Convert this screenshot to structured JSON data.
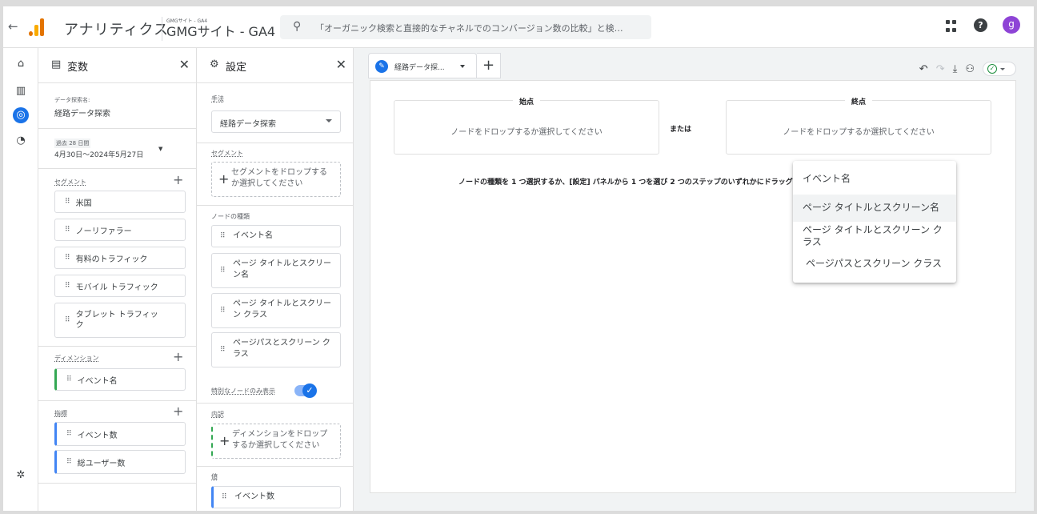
{
  "topbar": {
    "app_name": "アナリティクス",
    "property_small": "GMGサイト - GA4",
    "property_name": "GMGサイト - GA4",
    "search_placeholder": "「オーガニック検索と直接的なチャネルでのコンバージョン数の比較」と検…",
    "avatar_letter": "g",
    "help_label": "?"
  },
  "variables": {
    "title": "変数",
    "exploration_name_label": "データ探索名:",
    "exploration_name": "経路データ探索",
    "date_label": "過去 28 日間",
    "date_range": "4月30日～2024年5月27日",
    "segments_label": "セグメント",
    "segments": [
      "米国",
      "ノーリファラー",
      "有料のトラフィック",
      "モバイル トラフィック",
      "タブレット トラフィック"
    ],
    "dimensions_label": "ディメンション",
    "dimensions": [
      "イベント名"
    ],
    "metrics_label": "指標",
    "metrics": [
      "イベント数",
      "総ユーザー数"
    ]
  },
  "settings": {
    "title": "設定",
    "technique_label": "手法",
    "technique_value": "経路データ探索",
    "segment_label": "セグメント",
    "segment_drop": "セグメントをドロップするか選択してください",
    "node_type_label": "ノードの種類",
    "node_types": [
      "イベント名",
      "ページ タイトルとスクリーン名",
      "ページ タイトルとスクリーン クラス",
      "ページパスとスクリーン クラス"
    ],
    "unique_nodes_label": "特別なノードのみ表示",
    "unique_nodes_on": true,
    "breakdown_label": "内訳",
    "breakdown_drop": "ディメンションをドロップするか選択してください",
    "values_label": "値",
    "value_item": "イベント数"
  },
  "canvas": {
    "tab_label": "経路データ探...",
    "start_title": "始点",
    "end_title": "終点",
    "drop_hint": "ノードをドロップするか選択してください",
    "or_label": "または",
    "instruction": "ノードの種類を 1 つ選択するか、[設定] パネルから 1 つを選び 2 つのステップのいずれかにドラッグしてください"
  },
  "menu": {
    "items": [
      "イベント名",
      "ページ タイトルとスクリーン名",
      "ページ タイトルとスクリーン クラス",
      "ページパスとスクリーン クラス"
    ],
    "highlighted": "ページ タイトルとスクリーン名"
  },
  "colors": {
    "accent": "#1a73e8",
    "logo_orange": "#e37400",
    "logo_yellow": "#f9ab00",
    "avatar": "#8e44d6",
    "dimension_bar": "#34a853",
    "metric_bar": "#4285f4"
  }
}
